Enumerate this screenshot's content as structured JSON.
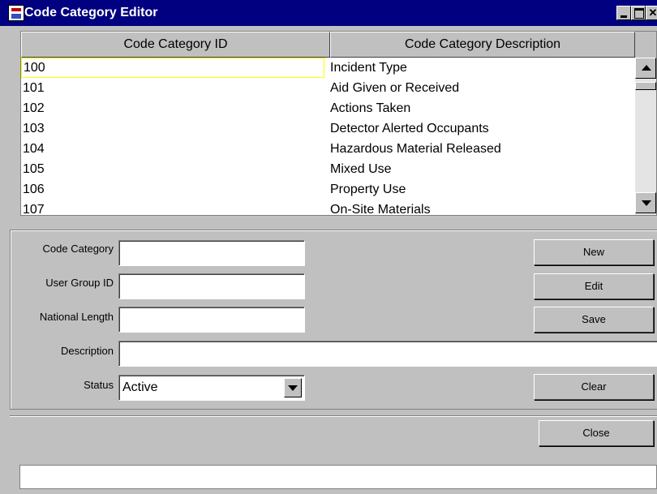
{
  "window": {
    "title": "Code Category Editor",
    "app_icon": "java-app-icon",
    "controls": [
      "minimize-icon",
      "maximize-icon",
      "close-icon"
    ]
  },
  "table": {
    "columns": [
      "Code Category ID",
      "Code Category Description"
    ],
    "rows": [
      {
        "id": "100",
        "description": "Incident Type"
      },
      {
        "id": "101",
        "description": "Aid Given or Received"
      },
      {
        "id": "102",
        "description": "Actions Taken"
      },
      {
        "id": "103",
        "description": "Detector Alerted Occupants"
      },
      {
        "id": "104",
        "description": "Hazardous Material Released"
      },
      {
        "id": "105",
        "description": "Mixed Use"
      },
      {
        "id": "106",
        "description": "Property Use"
      },
      {
        "id": "107",
        "description": "On-Site Materials"
      }
    ],
    "selected_row": 0,
    "selection_color": "#ffff00"
  },
  "form": {
    "code_category_label": "Code Category",
    "code_category_value": "",
    "user_group_label": "User Group ID",
    "user_group_value": "",
    "national_length_label": "National Length",
    "national_length_value": "",
    "description_label": "Description",
    "description_value": "",
    "status_label": "Status",
    "status_value": "Active"
  },
  "buttons": {
    "new": "New",
    "edit": "Edit",
    "save": "Save",
    "clear": "Clear",
    "close": "Close"
  },
  "status_bar": "",
  "colors": {
    "titlebar": "#000080",
    "window_bg": "#c0c0c0"
  }
}
